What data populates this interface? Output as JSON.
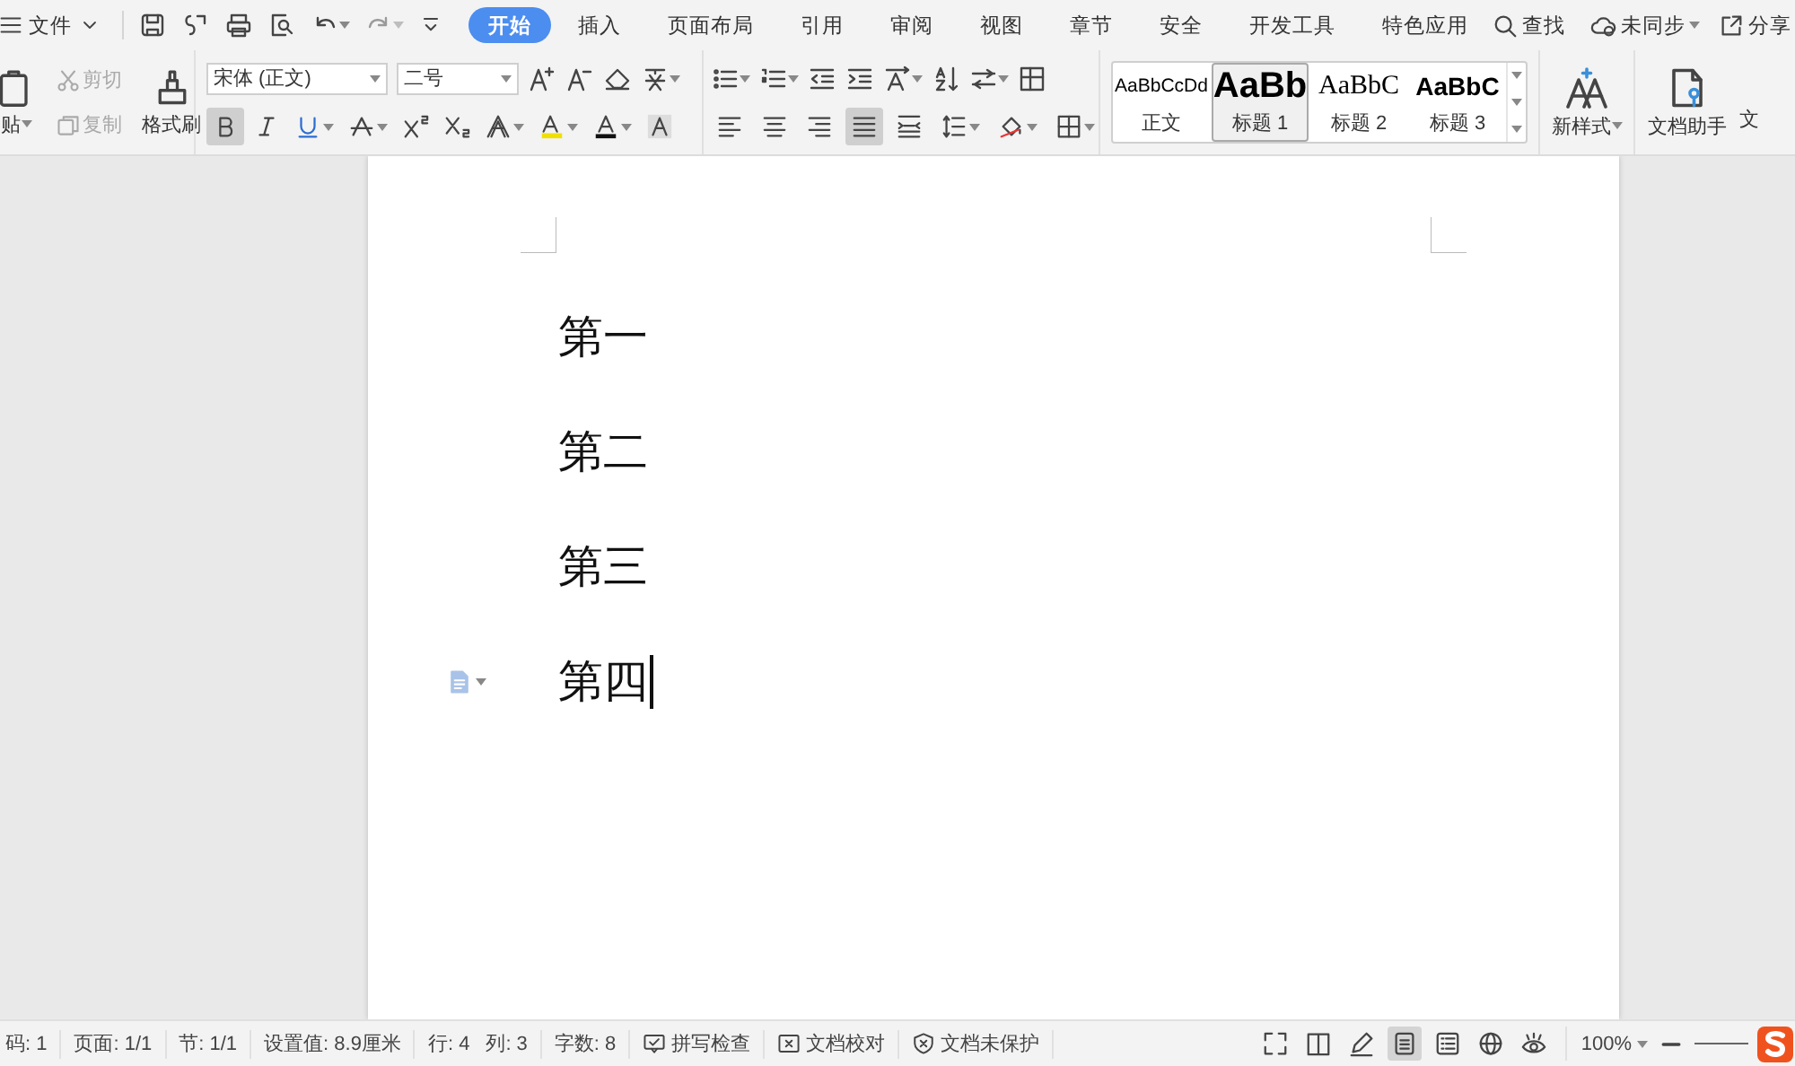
{
  "menu_bar": {
    "file_label": "文件",
    "tabs": [
      {
        "label": "开始",
        "selected": true
      },
      {
        "label": "插入",
        "selected": false
      },
      {
        "label": "页面布局",
        "selected": false
      },
      {
        "label": "引用",
        "selected": false
      },
      {
        "label": "审阅",
        "selected": false
      },
      {
        "label": "视图",
        "selected": false
      },
      {
        "label": "章节",
        "selected": false
      },
      {
        "label": "安全",
        "selected": false
      },
      {
        "label": "开发工具",
        "selected": false
      },
      {
        "label": "特色应用",
        "selected": false
      }
    ],
    "search_label": "查找",
    "sync_label": "未同步",
    "share_label": "分享"
  },
  "ribbon": {
    "clipboard": {
      "paste_label": "贴",
      "cut": {
        "label": "剪切",
        "disabled": true
      },
      "copy": {
        "label": "复制",
        "disabled": true
      },
      "format_painter_label": "格式刷"
    },
    "font": {
      "family": "宋体 (正文)",
      "size": "二号",
      "buttons": [
        {
          "kind": "bold",
          "selected": true
        },
        {
          "kind": "italic",
          "selected": false
        },
        {
          "kind": "underline",
          "selected": false
        },
        {
          "kind": "strike",
          "selected": false
        },
        {
          "kind": "superscript",
          "selected": false
        },
        {
          "kind": "subscript",
          "selected": false
        },
        {
          "kind": "effect",
          "selected": false
        },
        {
          "kind": "highlight",
          "selected": false
        },
        {
          "kind": "color",
          "selected": false
        },
        {
          "kind": "shade",
          "selected": false
        }
      ]
    },
    "paragraph": {
      "buttons": [
        {
          "kind": "align-left",
          "selected": false
        },
        {
          "kind": "align-center",
          "selected": false
        },
        {
          "kind": "align-right",
          "selected": false
        },
        {
          "kind": "justify",
          "selected": true
        },
        {
          "kind": "distribute",
          "selected": false
        },
        {
          "kind": "line-spacing",
          "selected": false
        },
        {
          "kind": "fill",
          "selected": false
        },
        {
          "kind": "border",
          "selected": false
        }
      ]
    },
    "styles": [
      {
        "kind": "body",
        "preview": "AaBbCcDd",
        "label": "正文",
        "selected": false
      },
      {
        "kind": "h1",
        "preview": "AaBb",
        "label": "标题 1",
        "selected": true
      },
      {
        "kind": "h2",
        "preview": "AaBbC",
        "label": "标题 2",
        "selected": false
      },
      {
        "kind": "h3",
        "preview": "AaBbC",
        "label": "标题 3",
        "selected": false
      }
    ],
    "new_style_label": "新样式",
    "assistant_label": "文档助手",
    "cut_label": "文"
  },
  "document": {
    "paragraphs": [
      "第一",
      "第二",
      "第三",
      "第四"
    ]
  },
  "status_bar": {
    "items": [
      {
        "kind": "text",
        "label": "码: 1"
      },
      {
        "kind": "text",
        "label": "页面: 1/1"
      },
      {
        "kind": "text",
        "label": "节: 1/1"
      },
      {
        "kind": "text",
        "label": "设置值: 8.9厘米"
      },
      {
        "kind": "text",
        "label": "行: 4"
      },
      {
        "kind": "text",
        "label": "列: 3"
      },
      {
        "kind": "text",
        "label": "字数: 8"
      },
      {
        "kind": "spell",
        "label": "拼写检查"
      },
      {
        "kind": "proof",
        "label": "文档校对"
      },
      {
        "kind": "protect",
        "label": "文档未保护"
      }
    ],
    "views": [
      {
        "kind": "fullscreen",
        "selected": false
      },
      {
        "kind": "reading",
        "selected": false
      },
      {
        "kind": "pen",
        "selected": false
      },
      {
        "kind": "page",
        "selected": true
      },
      {
        "kind": "outline",
        "selected": false
      },
      {
        "kind": "web",
        "selected": false
      },
      {
        "kind": "eye",
        "selected": false
      }
    ],
    "zoom": "100%"
  }
}
